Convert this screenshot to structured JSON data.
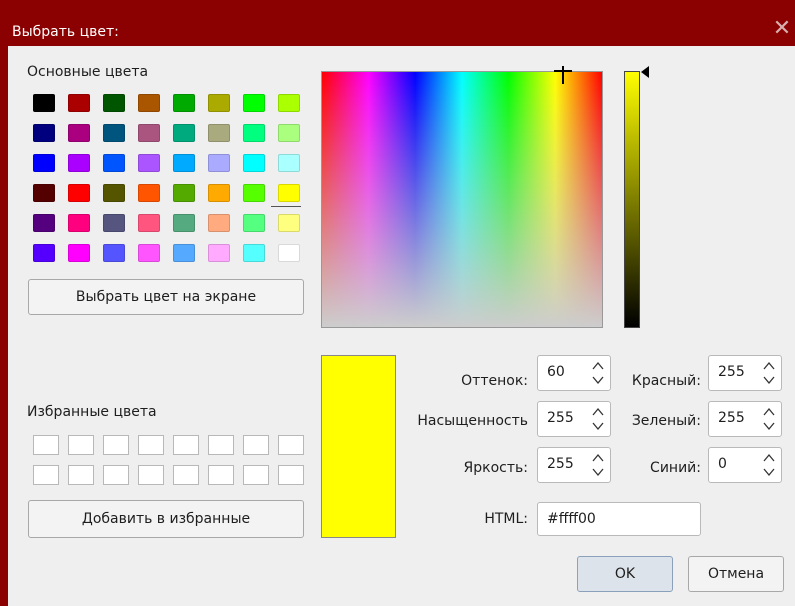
{
  "window": {
    "title": "Выбрать цвет:",
    "close_glyph": "✕",
    "frame_color": "#8b0000"
  },
  "basic_colors": {
    "label": "Основные цвета",
    "rows": [
      [
        "#000000",
        "#aa0000",
        "#005500",
        "#aa5500",
        "#00aa00",
        "#aaaa00",
        "#00ff00",
        "#aaff00"
      ],
      [
        "#00007f",
        "#aa007f",
        "#00557f",
        "#aa557f",
        "#00aa7f",
        "#aaaa7f",
        "#00ff7f",
        "#aaff7f"
      ],
      [
        "#0000ff",
        "#aa00ff",
        "#0055ff",
        "#aa55ff",
        "#00aaff",
        "#aaaaff",
        "#00ffff",
        "#aaffff"
      ],
      [
        "#550000",
        "#ff0000",
        "#555500",
        "#ff5500",
        "#55aa00",
        "#ffaa00",
        "#55ff00",
        "#ffff00"
      ],
      [
        "#55007f",
        "#ff007f",
        "#55557f",
        "#ff557f",
        "#55aa7f",
        "#ffaa7f",
        "#55ff7f",
        "#ffff7f"
      ],
      [
        "#5500ff",
        "#ff00ff",
        "#5555ff",
        "#ff55ff",
        "#55aaff",
        "#ffaaff",
        "#55ffff",
        "#ffffff"
      ]
    ],
    "selected_color": "#ffff00"
  },
  "pick_screen_button": "Выбрать цвет на экране",
  "custom_colors": {
    "label": "Избранные цвета",
    "rows": [
      [
        "#ffffff",
        "#ffffff",
        "#ffffff",
        "#ffffff",
        "#ffffff",
        "#ffffff",
        "#ffffff",
        "#ffffff"
      ],
      [
        "#ffffff",
        "#ffffff",
        "#ffffff",
        "#ffffff",
        "#ffffff",
        "#ffffff",
        "#ffffff",
        "#ffffff"
      ]
    ]
  },
  "add_custom_button": "Добавить в избранные",
  "current_color": "#ffff00",
  "fields": {
    "hue": {
      "label": "Оттенок:",
      "value": "60"
    },
    "saturation": {
      "label": "Насыщенность",
      "value": "255"
    },
    "value": {
      "label": "Яркость:",
      "value": "255"
    },
    "red": {
      "label": "Красный:",
      "value": "255"
    },
    "green": {
      "label": "Зеленый:",
      "value": "255"
    },
    "blue": {
      "label": "Синий:",
      "value": "0"
    },
    "html": {
      "label": "HTML:",
      "value": "#ffff00"
    }
  },
  "ok_button": "OK",
  "cancel_button": "Отмена"
}
